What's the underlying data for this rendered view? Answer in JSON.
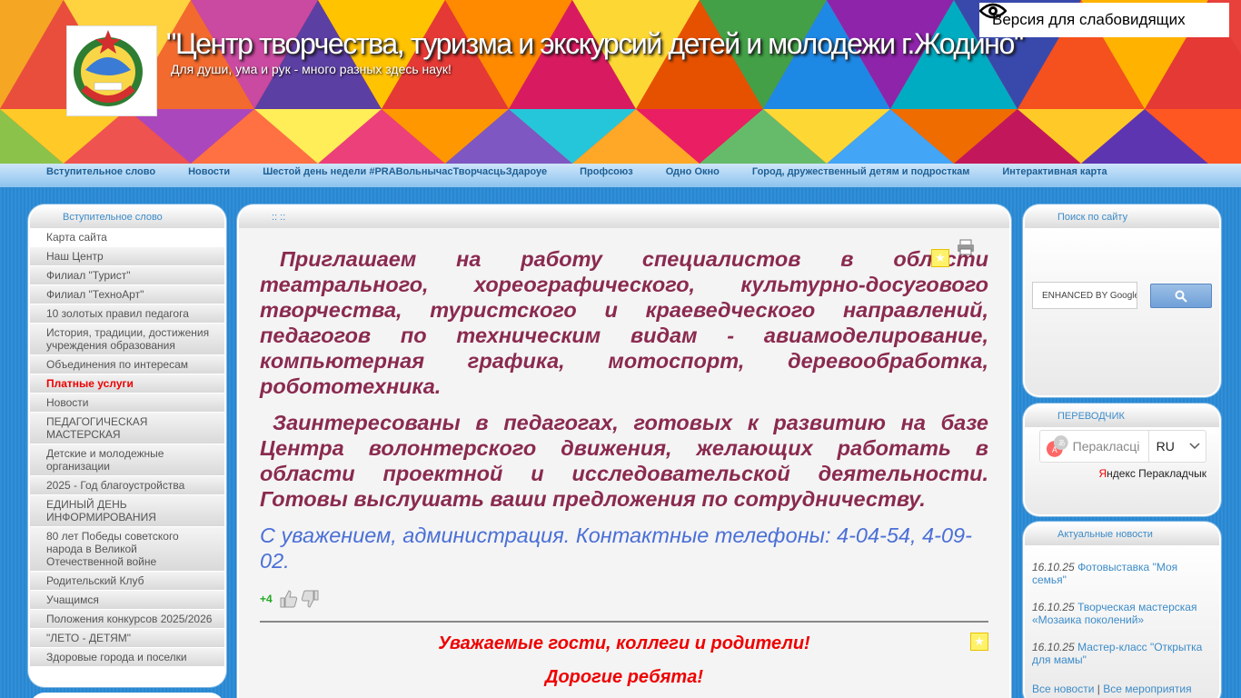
{
  "header": {
    "title": "\"Центр творчества, туризма и экскурсий детей и молодежи г.Жодино\"",
    "slogan": "Для души, ума и рук - много разных здесь наук!",
    "logo_text": "РЭСПУБЛIКА БЕЛАРУСЬ",
    "accessibility_label": "Версия для слабовидящих"
  },
  "topnav": [
    "Вступительное слово",
    "Новости",
    "Шестой день недели #PRAВольнычасТворчасцьЗдароуе",
    "Профсоюз",
    "Одно Окно",
    "Город, дружественный детям и подросткам",
    "Интерактивная карта"
  ],
  "sidebar": {
    "title": "Вступительное слово",
    "items": [
      "Карта сайта",
      "Наш Центр",
      "Филиал \"Турист\"",
      "Филиал \"ТехноАрт\"",
      "10 золотых правил педагога",
      "История, традиции, достижения учреждения образования",
      "Объединения по интересам",
      "Платные услуги",
      "Новости",
      "ПЕДАГОГИЧЕСКАЯ МАСТЕРСКАЯ",
      "Детские и молодежные организации",
      "2025 - Год благоустройства",
      "ЕДИНЫЙ ДЕНЬ ИНФОРМИРОВАНИЯ",
      "80 лет Победы советского народа в Великой Отечественной войне",
      "Родительский Клуб",
      "Учащимся",
      "Положения конкурсов 2025/2026",
      "\"ЛЕТО - ДЕТЯМ\"",
      "Здоровые города и поселки"
    ],
    "active_index": 7
  },
  "main": {
    "header": ":: ::",
    "para1": "Приглашаем на работу специалистов в области театрального, хореографического, культурно-досугового творчества, туристского и краеведческого направлений, педагогов по техническим видам - авиамоделирование, компьютерная графика, мотоспорт, деревообработка, робототехника.",
    "para2": "Заинтересованы в педагогах, готовых к развитию на базе Центра волонтерского движения, желающих работать в области проектной и исследовательской деятельности. Готовы выслушать ваши предложения по сотрудничеству.",
    "para3": "С уважением, администрация. Контактные телефоны: 4-04-54, 4-09-02.",
    "rating": "+4",
    "greeting1": "Уважаемые гости,  коллеги и родители!",
    "greeting2": "Дорогие ребята!"
  },
  "search": {
    "title": "Поиск по сайту",
    "placeholder": "ENHANCED BY Google"
  },
  "translator": {
    "title": "ПЕРЕВОДЧИК",
    "placeholder": "Перакласці",
    "lang": "RU",
    "brand_y": "Я",
    "brand_rest": "ндекс Перакладчык"
  },
  "news": {
    "title": "Актуальные новости",
    "items": [
      {
        "date": "16.10.25",
        "text": "Фотовыставка \"Моя семья\""
      },
      {
        "date": "16.10.25",
        "text": "Творческая мастерская «Мозаика поколений»"
      },
      {
        "date": "16.10.25",
        "text": "Мастер-класс \"Открытка для мамы\""
      }
    ],
    "all_news": "Все новости",
    "separator": "|",
    "all_events": "Все мероприятия"
  }
}
